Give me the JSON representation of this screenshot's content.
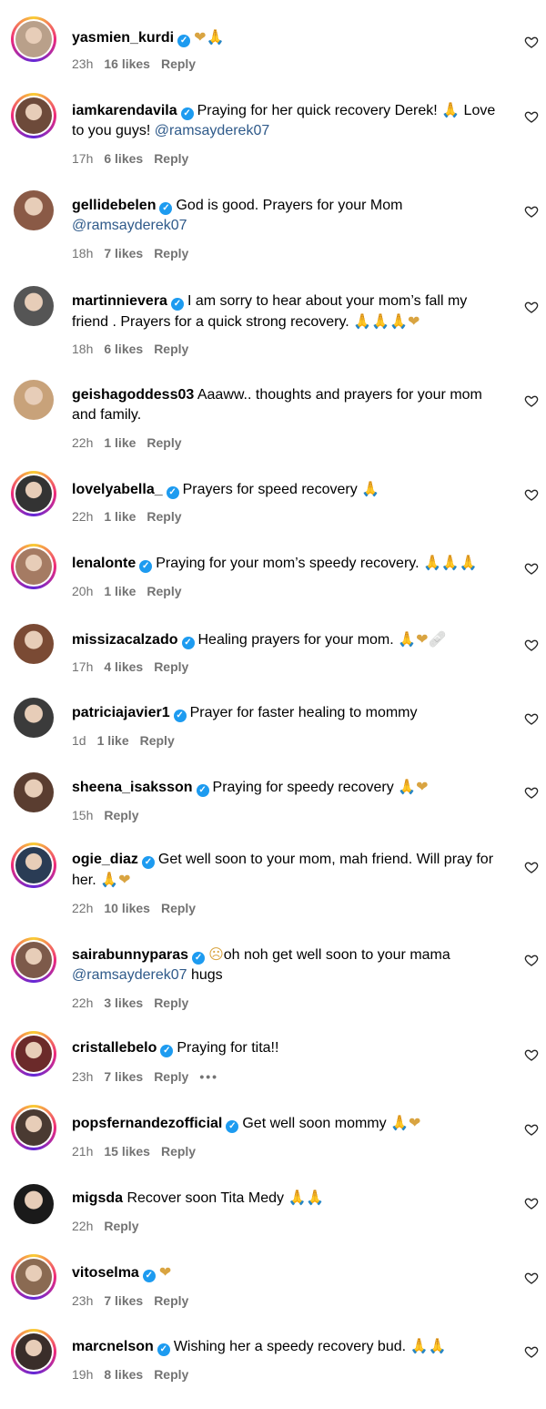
{
  "comments": [
    {
      "user": "yasmien_kurdi",
      "verified": true,
      "text": "",
      "emojis": "❤🙏",
      "time": "23h",
      "likes": "16 likes",
      "reply": "Reply"
    },
    {
      "user": "iamkarendavila",
      "verified": true,
      "text": "Praying for her quick recovery Derek! 🙏 Love to you guys!",
      "mention": "@ramsayderek07",
      "time": "17h",
      "likes": "6 likes",
      "reply": "Reply"
    },
    {
      "user": "gellidebelen",
      "verified": true,
      "text": "God is good. Prayers for your Mom",
      "mention": "@ramsayderek07",
      "time": "18h",
      "likes": "7 likes",
      "reply": "Reply"
    },
    {
      "user": "martinnievera",
      "verified": true,
      "text": "I am sorry to hear about your mom’s fall my friend . Prayers for a quick strong recovery.",
      "emojis": "🙏🙏🙏❤",
      "time": "18h",
      "likes": "6 likes",
      "reply": "Reply"
    },
    {
      "user": "geishagoddess03",
      "verified": false,
      "text": "Aaaww.. thoughts and prayers for your mom and family.",
      "time": "22h",
      "likes": "1 like",
      "reply": "Reply"
    },
    {
      "user": "lovelyabella_",
      "verified": true,
      "text": "Prayers for speed recovery",
      "emojis": "🙏",
      "time": "22h",
      "likes": "1 like",
      "reply": "Reply"
    },
    {
      "user": "lenalonte",
      "verified": true,
      "text": "Praying for your mom’s speedy recovery.",
      "emojis": "🙏🙏🙏",
      "time": "20h",
      "likes": "1 like",
      "reply": "Reply"
    },
    {
      "user": "missizacalzado",
      "verified": true,
      "text": "Healing prayers for your mom.",
      "emojis": "🙏❤🩹",
      "time": "17h",
      "likes": "4 likes",
      "reply": "Reply"
    },
    {
      "user": "patriciajavier1",
      "verified": true,
      "text": "Prayer for faster healing to mommy",
      "time": "1d",
      "likes": "1 like",
      "reply": "Reply"
    },
    {
      "user": "sheena_isaksson",
      "verified": true,
      "text": "Praying for speedy recovery",
      "emojis": "🙏❤",
      "time": "15h",
      "likes": "",
      "reply": "Reply"
    },
    {
      "user": "ogie_diaz",
      "verified": true,
      "text": "Get well soon to your mom, mah friend. Will pray for her.",
      "emojis": "🙏❤",
      "time": "22h",
      "likes": "10 likes",
      "reply": "Reply"
    },
    {
      "user": "sairabunnyparas",
      "verified": true,
      "text": "oh noh get well soon to your mama",
      "pre_emoji": "☹",
      "mention": "@ramsayderek07",
      "after_mention": "hugs",
      "time": "22h",
      "likes": "3 likes",
      "reply": "Reply"
    },
    {
      "user": "cristallebelo",
      "verified": true,
      "text": "Praying for tita!!",
      "time": "23h",
      "likes": "7 likes",
      "reply": "Reply",
      "more": "•••"
    },
    {
      "user": "popsfernandezofficial",
      "verified": true,
      "text": "Get well soon mommy",
      "emojis": "🙏❤",
      "time": "21h",
      "likes": "15 likes",
      "reply": "Reply"
    },
    {
      "user": "migsda",
      "verified": false,
      "text": "Recover soon Tita Medy",
      "emojis": "🙏🙏",
      "time": "22h",
      "likes": "",
      "reply": "Reply"
    },
    {
      "user": "vitoselma",
      "verified": true,
      "text": "",
      "emojis": "❤",
      "time": "23h",
      "likes": "7 likes",
      "reply": "Reply"
    },
    {
      "user": "marcnelson",
      "verified": true,
      "text": "Wishing her a speedy recovery bud.",
      "emojis": "🙏🙏",
      "time": "19h",
      "likes": "8 likes",
      "reply": "Reply"
    }
  ],
  "icons": {
    "like": "heart-outline-icon",
    "verified": "verified-badge-icon",
    "avatar": "avatar"
  },
  "colors": {
    "verified": "#1d9bf0",
    "meta": "#737373",
    "mention": "#2f5a8a",
    "ring_start": "#f9ce34",
    "ring_mid": "#ee2a7b",
    "ring_end": "#6228d7"
  }
}
